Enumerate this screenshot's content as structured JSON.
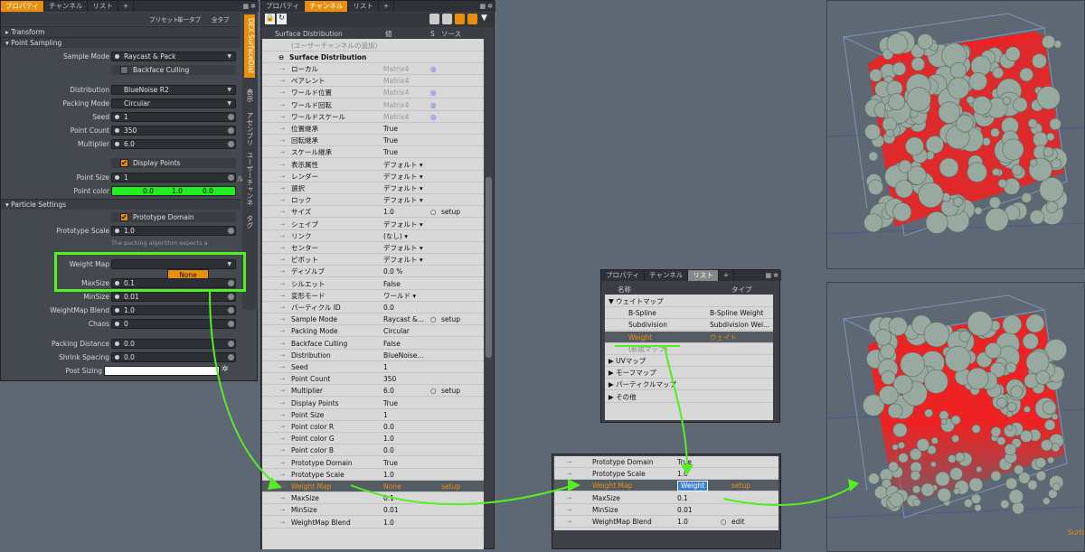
{
  "left_panel": {
    "tabs": [
      "プロパティ",
      "チャンネル",
      "リスト"
    ],
    "preset_label": "プリセット",
    "single_tab": "単一タブ",
    "all_tab": "全タブ",
    "sections": {
      "transform": "Transform",
      "point_sampling": "Point Sampling",
      "particle_settings": "Particle Settings"
    },
    "sample_mode": {
      "label": "Sample Mode",
      "value": "Raycast & Pack"
    },
    "backface_culling": "Backface Culling",
    "distribution": {
      "label": "Distribution",
      "value": "BlueNoise R2"
    },
    "packing_mode": {
      "label": "Packing Mode",
      "value": "Circular"
    },
    "seed": {
      "label": "Seed",
      "value": "1"
    },
    "point_count": {
      "label": "Point Count",
      "value": "350"
    },
    "multiplier": {
      "label": "Multiplier",
      "value": "6.0"
    },
    "display_points": "Display Points",
    "point_size": {
      "label": "Point Size",
      "value": "1"
    },
    "point_color": {
      "label": "Point color",
      "r": "0.0",
      "g": "1.0",
      "b": "0.0"
    },
    "prototype_domain": "Prototype Domain",
    "prototype_scale": {
      "label": "Prototype Scale",
      "value": "1.0"
    },
    "hint": "The packing algorithm expects a",
    "weight_map": {
      "label": "Weight Map",
      "dropdown_option": "None"
    },
    "maxsize": {
      "label": "MaxSize",
      "value": "0.1"
    },
    "minsize": {
      "label": "MinSize",
      "value": "0.01"
    },
    "weightmap_blend": {
      "label": "WeightMap Blend",
      "value": "1.0"
    },
    "chaos": {
      "label": "Chaos",
      "value": "0"
    },
    "packing_distance": {
      "label": "Packing Distance",
      "value": "0.0"
    },
    "shrink_spacing": {
      "label": "Shrink Spacing",
      "value": "0.0"
    },
    "post_sizing": {
      "label": "Post Sizing"
    },
    "vertical_tabs": [
      "DEX SurfaceDist",
      "表示",
      "アセンブリ",
      "ユーザーチャンネル",
      "タグ"
    ]
  },
  "channel_panel": {
    "tabs": [
      "プロパティ",
      "チャンネル",
      "リスト"
    ],
    "headers": [
      "Surface Distribution",
      "値",
      "S",
      "ソース"
    ],
    "add_channel": "(ユーザーチャンネルの追加)",
    "group": "Surface Distribution",
    "rows": [
      [
        "ローカル",
        "Matrix4",
        "◎",
        ""
      ],
      [
        "ペアレント",
        "Matrix4",
        "",
        ""
      ],
      [
        "ワールド位置",
        "Matrix4",
        "◎",
        ""
      ],
      [
        "ワールド回転",
        "Matrix4",
        "◎",
        ""
      ],
      [
        "ワールドスケール",
        "Matrix4",
        "◎",
        ""
      ],
      [
        "位置継承",
        "True",
        "",
        ""
      ],
      [
        "回転継承",
        "True",
        "",
        ""
      ],
      [
        "スケール継承",
        "True",
        "",
        ""
      ],
      [
        "表示属性",
        "デフォルト ▾",
        "",
        ""
      ],
      [
        "レンダー",
        "デフォルト ▾",
        "",
        ""
      ],
      [
        "選択",
        "デフォルト ▾",
        "",
        ""
      ],
      [
        "ロック",
        "デフォルト ▾",
        "",
        ""
      ],
      [
        "サイズ",
        "1.0",
        "○",
        "setup"
      ],
      [
        "シェイプ",
        "デフォルト ▾",
        "",
        ""
      ],
      [
        "リンク",
        "(なし) ▾",
        "",
        ""
      ],
      [
        "センター",
        "デフォルト ▾",
        "",
        ""
      ],
      [
        "ピボット",
        "デフォルト ▾",
        "",
        ""
      ],
      [
        "ディゾルブ",
        "0.0 %",
        "",
        ""
      ],
      [
        "シルエット",
        "False",
        "",
        ""
      ],
      [
        "変形モード",
        "ワールド ▾",
        "",
        ""
      ],
      [
        "パーティクル ID",
        "0.0",
        "",
        ""
      ],
      [
        "Sample Mode",
        "Raycast &...",
        "○",
        "setup"
      ],
      [
        "Packing Mode",
        "Circular",
        "",
        ""
      ],
      [
        "Backface Culling",
        "False",
        "",
        ""
      ],
      [
        "Distribution",
        "BlueNoise...",
        "",
        ""
      ],
      [
        "Seed",
        "1",
        "",
        ""
      ],
      [
        "Point Count",
        "350",
        "",
        ""
      ],
      [
        "Multiplier",
        "6.0",
        "○",
        "setup"
      ],
      [
        "Display Points",
        "True",
        "",
        ""
      ],
      [
        "Point Size",
        "1",
        "",
        ""
      ],
      [
        "Point color R",
        "0.0",
        "",
        ""
      ],
      [
        "Point color G",
        "1.0",
        "",
        ""
      ],
      [
        "Point color B",
        "0.0",
        "",
        ""
      ],
      [
        "Prototype Domain",
        "True",
        "",
        ""
      ],
      [
        "Prototype Scale",
        "1.0",
        "",
        ""
      ],
      [
        "Weight Map",
        "None",
        "",
        "setup"
      ],
      [
        "MaxSize",
        "0.1",
        "",
        ""
      ],
      [
        "MinSize",
        "0.01",
        "",
        ""
      ],
      [
        "WeightMap Blend",
        "1.0",
        "",
        ""
      ]
    ]
  },
  "list_panel": {
    "tabs": [
      "プロパティ",
      "チャンネル",
      "リスト"
    ],
    "headers": [
      "名称",
      "タイプ"
    ],
    "rows": [
      [
        "▼ ウェイトマップ",
        ""
      ],
      [
        "B-Spline",
        "B-Spline Weight"
      ],
      [
        "Subdivision",
        "Subdivision Wei..."
      ],
      [
        "Weight",
        "ウェイト"
      ],
      [
        "(新規マップ)",
        ""
      ],
      [
        "▶ UVマップ",
        ""
      ],
      [
        "▶ モーフマップ",
        ""
      ],
      [
        "▶ パーティクルマップ",
        ""
      ],
      [
        "▶ その他",
        ""
      ]
    ]
  },
  "result_panel": {
    "rows": [
      [
        "Prototype Domain",
        "True",
        "",
        ""
      ],
      [
        "Prototype Scale",
        "1.0",
        "",
        ""
      ],
      [
        "Weight Map",
        "Weight",
        "",
        "setup"
      ],
      [
        "MaxSize",
        "0.1",
        "",
        ""
      ],
      [
        "MinSize",
        "0.01",
        "",
        ""
      ],
      [
        "WeightMap Blend",
        "1.0",
        "○",
        "edit"
      ]
    ]
  },
  "viewport": {
    "label": "Surfa"
  },
  "colors": {
    "accent": "#e8900e",
    "green_annot": "#55ee22",
    "highlight_red": "#ff2a2a"
  }
}
